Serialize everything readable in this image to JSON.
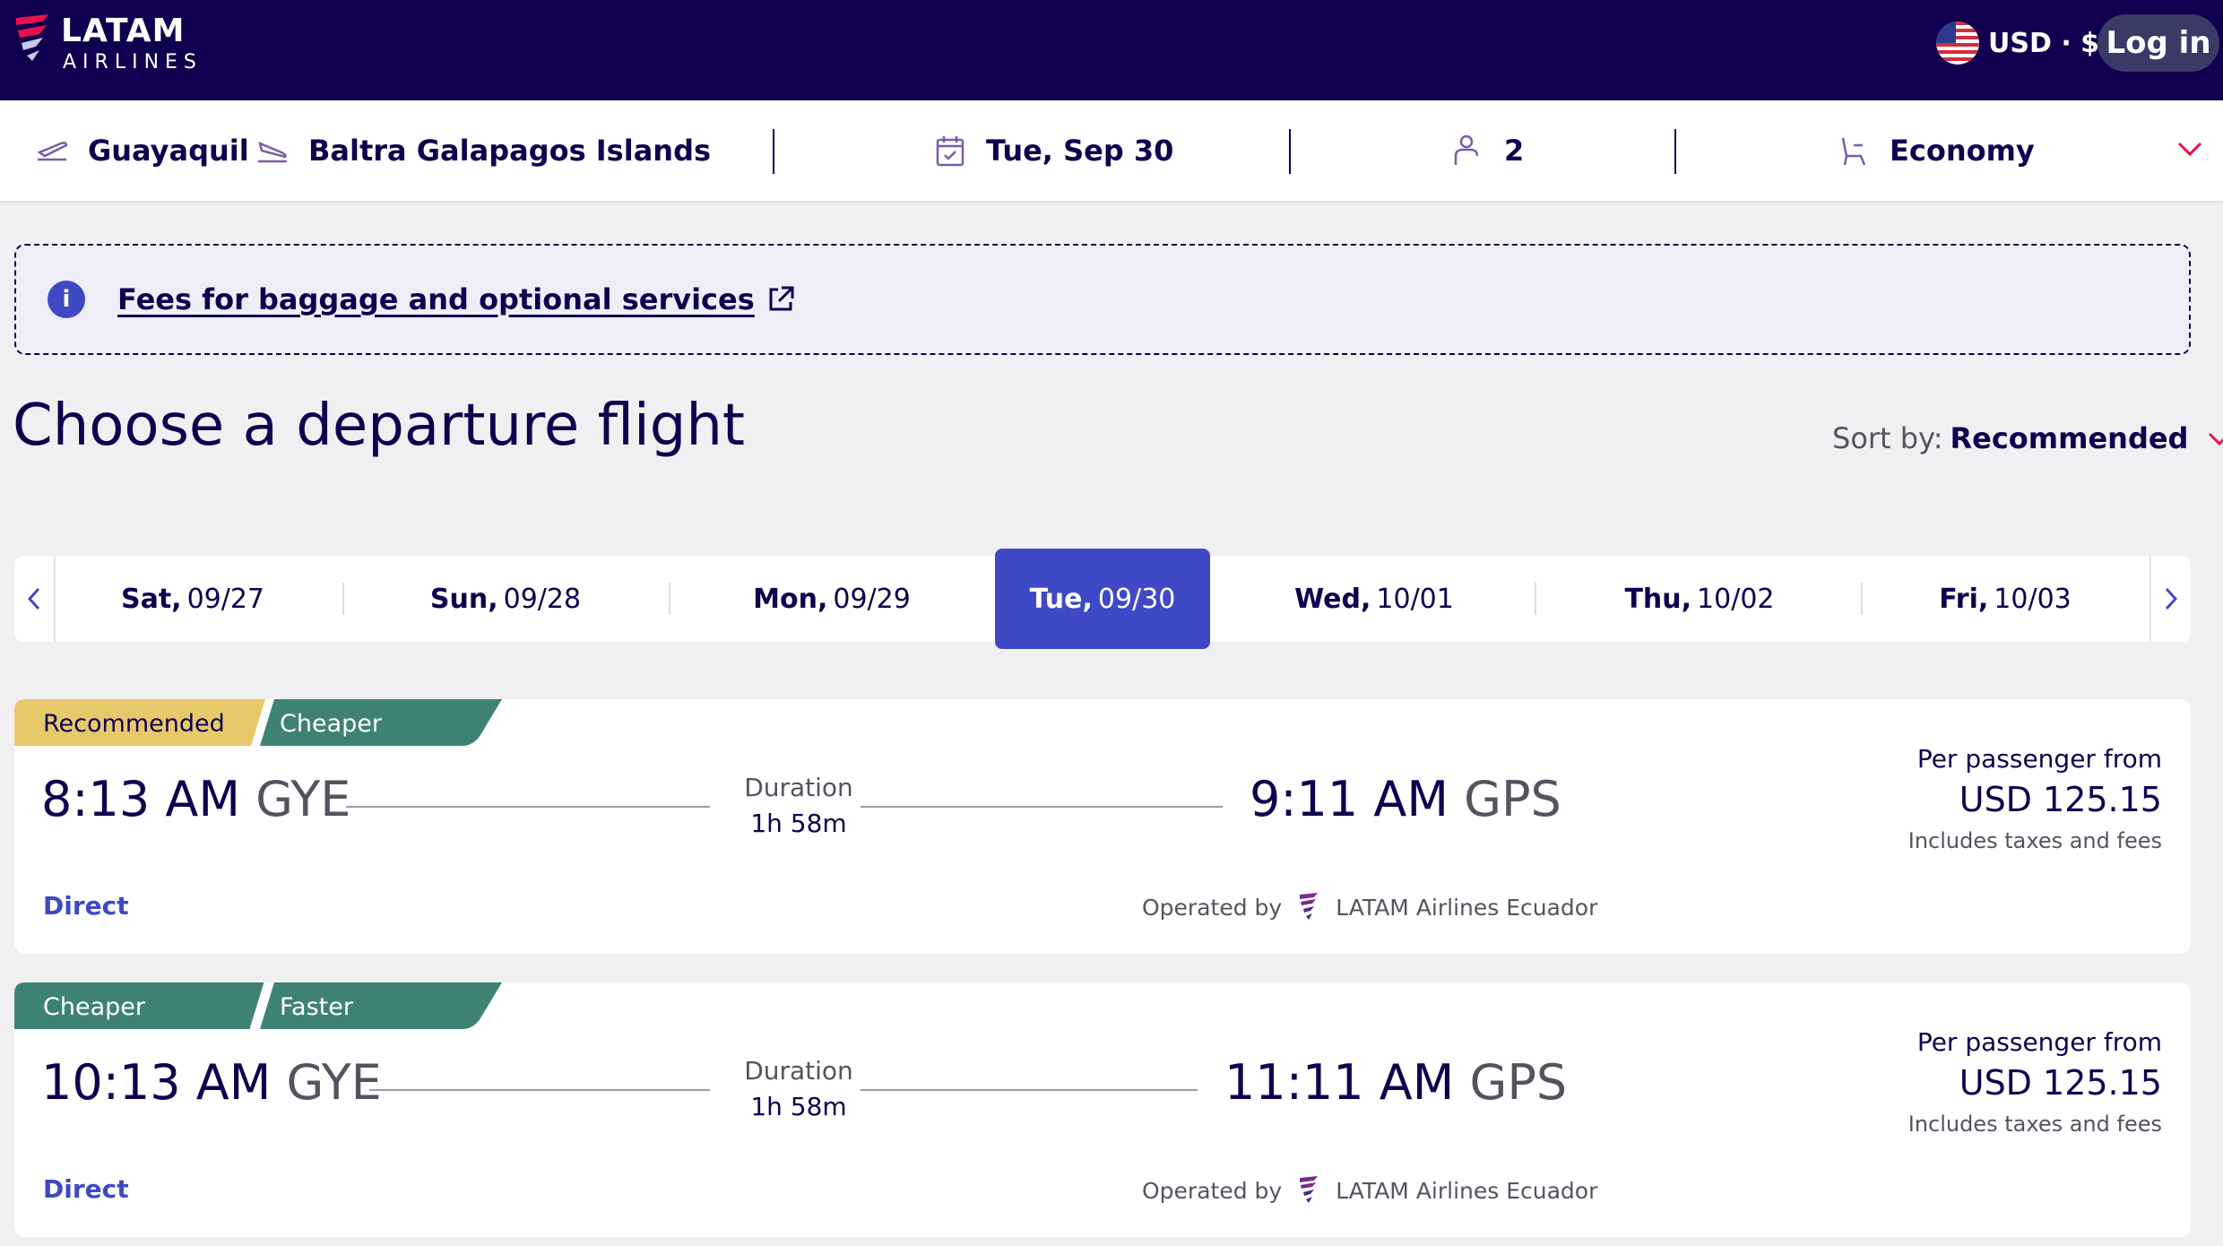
{
  "header": {
    "logo_text": "LATAM",
    "logo_subtext": "AIRLINES",
    "currency": "USD · $",
    "login_label": "Log in"
  },
  "search": {
    "origin": "Guayaquil",
    "destination": "Baltra Galapagos Islands",
    "date": "Tue, Sep 30",
    "passengers": "2",
    "cabin": "Economy"
  },
  "info": {
    "link_text": "Fees for baggage and optional services"
  },
  "heading": {
    "prefix": "Choose a",
    "main": "departure flight"
  },
  "sort": {
    "label": "Sort by:",
    "value": "Recommended"
  },
  "dates": [
    {
      "day": "Sat,",
      "date": "09/27"
    },
    {
      "day": "Sun,",
      "date": "09/28"
    },
    {
      "day": "Mon,",
      "date": "09/29"
    },
    {
      "day": "Tue,",
      "date": "09/30",
      "selected": true
    },
    {
      "day": "Wed,",
      "date": "10/01"
    },
    {
      "day": "Thu,",
      "date": "10/02"
    },
    {
      "day": "Fri,",
      "date": "10/03"
    }
  ],
  "flights": [
    {
      "tags": [
        "Recommended",
        "Cheaper"
      ],
      "depart_time": "8:13 AM",
      "depart_code": "GYE",
      "duration_label": "Duration",
      "duration": "1h 58m",
      "arrive_time": "9:11 AM",
      "arrive_code": "GPS",
      "price_label": "Per passenger from",
      "price": "USD 125.15",
      "price_note": "Includes taxes and fees",
      "stops": "Direct",
      "operated_label": "Operated by",
      "operator": "LATAM Airlines Ecuador"
    },
    {
      "tags": [
        "Cheaper",
        "Faster"
      ],
      "depart_time": "10:13 AM",
      "depart_code": "GYE",
      "duration_label": "Duration",
      "duration": "1h 58m",
      "arrive_time": "11:11 AM",
      "arrive_code": "GPS",
      "price_label": "Per passenger from",
      "price": "USD 125.15",
      "price_note": "Includes taxes and fees",
      "stops": "Direct",
      "operated_label": "Operated by",
      "operator": "LATAM Airlines Ecuador"
    }
  ],
  "colors": {
    "navy": "#10004f",
    "accent_blue": "#3f49c6",
    "tag_yellow": "#e8c96a",
    "tag_teal": "#3e8276",
    "chevron_red": "#e8114b"
  }
}
